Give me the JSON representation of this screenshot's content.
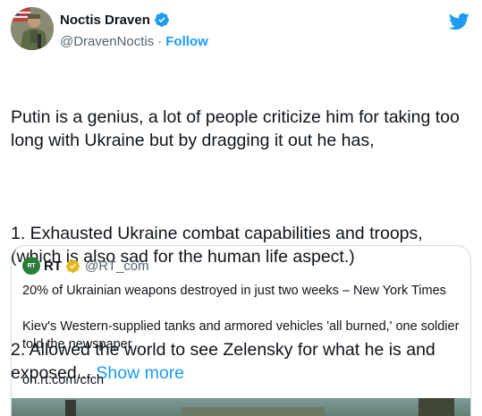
{
  "tweet": {
    "author": {
      "name": "Noctis Draven",
      "handle": "@DravenNoctis",
      "separator": "·",
      "follow_label": "Follow",
      "verified_icon": "verified-badge-icon"
    },
    "brand_icon": "twitter-bird-icon",
    "text": {
      "p1": "Putin is a genius, a lot of people criticize him for taking too long with Ukraine but by dragging it out he has,",
      "p2": "1. Exhausted Ukraine combat capabilities and troops, (which is also sad for the human life aspect.)",
      "p3": "2. Allowed the world to see Zelensky for what he is and exposed... ",
      "show_more": "Show more"
    },
    "quote": {
      "avatar_text": "RT",
      "name": "RT",
      "handle": "@RT_com",
      "line1": "20% of Ukrainian weapons destroyed in just two weeks – New York Times",
      "line2": "Kiev's Western-supplied tanks and armored vehicles 'all burned,' one soldier told the newspaper",
      "link": "on.rt.com/cfch"
    }
  },
  "colors": {
    "accent": "#1d9bf0",
    "text": "#0f1419",
    "secondary": "#536471",
    "border": "#cfd9de",
    "verified_gold": "#e2b719"
  }
}
